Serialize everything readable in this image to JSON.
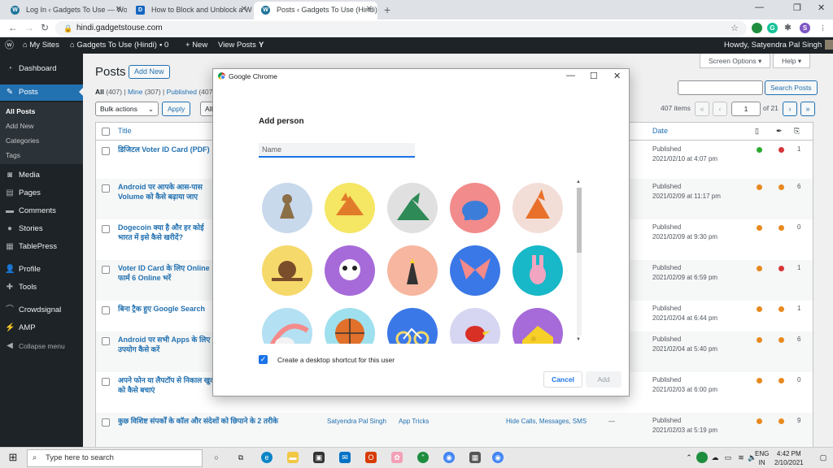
{
  "browser": {
    "tabs": [
      {
        "label": "Log In ‹ Gadgets To Use — WordPress",
        "fav": "W"
      },
      {
        "label": "How to Block and Unblock a Website",
        "fav": "D"
      },
      {
        "label": "Posts ‹ Gadgets To Use (Hindi) — WordPress",
        "fav": "W"
      }
    ],
    "url": "hindi.gadgetstouse.com",
    "profile_initial": "S"
  },
  "adminbar": {
    "my_sites": "My Sites",
    "site_name": "Gadgets To Use (Hindi)",
    "comments_count": "0",
    "new": "New",
    "view_posts": "View Posts",
    "howdy": "Howdy, Satyendra Pal Singh"
  },
  "sidebar": {
    "items": [
      {
        "label": "Dashboard",
        "icon": "dashboard-icon"
      },
      {
        "label": "Posts",
        "icon": "pin-icon"
      },
      {
        "label": "Media",
        "icon": "media-icon"
      },
      {
        "label": "Pages",
        "icon": "pages-icon"
      },
      {
        "label": "Comments",
        "icon": "comments-icon"
      },
      {
        "label": "Stories",
        "icon": "stories-icon"
      },
      {
        "label": "TablePress",
        "icon": "table-icon"
      },
      {
        "label": "Profile",
        "icon": "profile-icon"
      },
      {
        "label": "Tools",
        "icon": "tools-icon"
      },
      {
        "label": "Crowdsignal",
        "icon": "crowdsignal-icon"
      },
      {
        "label": "AMP",
        "icon": "amp-icon"
      },
      {
        "label": "Collapse menu",
        "icon": "collapse-icon"
      }
    ],
    "submenu": [
      "All Posts",
      "Add New",
      "Categories",
      "Tags"
    ]
  },
  "main": {
    "title": "Posts",
    "add_new": "Add New",
    "screen_options": "Screen Options ▾",
    "help": "Help ▾",
    "filters": {
      "all": "All",
      "all_count": "(407)",
      "mine": "Mine",
      "mine_count": "(307)",
      "published": "Published",
      "published_count": "(407"
    },
    "search_button": "Search Posts",
    "bulk_actions": "Bulk actions",
    "apply": "Apply",
    "filter_all_partial": "All",
    "items_count": "407 items",
    "page_input": "1",
    "of_pages": "of 21",
    "col_title": "Title",
    "col_date": "Date",
    "rows": [
      {
        "title": "डिजिटल Voter ID Card (PDF)",
        "status": "Published",
        "date": "2021/02/10 at 4:07 pm",
        "seo": "#2eaa2e",
        "read": "#d63638",
        "comments": "1"
      },
      {
        "title": "Android पर आपके आस-पास Volume को कैसे बढ़ाया जाए",
        "status": "Published",
        "date": "2021/02/09 at 11:17 pm",
        "seo": "#e8891f",
        "read": "#e8891f",
        "comments": "6"
      },
      {
        "title": "Dogecoin क्या है और हर कोई भारत में इसे कैसे खरीदें?",
        "status": "Published",
        "date": "2021/02/09 at 9:30 pm",
        "seo": "#e8891f",
        "read": "#e8891f",
        "comments": "0"
      },
      {
        "title": "Voter ID Card के लिए Online फार्म 6 Online भरें",
        "status": "Published",
        "date": "2021/02/09 at 6:59 pm",
        "seo": "#e8891f",
        "read": "#d63638",
        "comments": "1"
      },
      {
        "title": "बिना ट्रैक हुए Google Search",
        "status": "Published",
        "date": "2021/02/04 at 6:44 pm",
        "seo": "#e8891f",
        "read": "#e8891f",
        "comments": "1"
      },
      {
        "title": "Android पर सभी Apps के लिए उपयोग कैसे करें",
        "status": "Published",
        "date": "2021/02/04 at 5:40 pm",
        "seo": "#e8891f",
        "read": "#e8891f",
        "comments": "6"
      },
      {
        "title": "अपने फोन या लैपटॉप से निकाल खुद को कैसे बचाएं",
        "status": "Published",
        "date": "2021/02/03 at 6:00 pm",
        "seo": "#e8891f",
        "read": "#e8891f",
        "comments": "0"
      },
      {
        "title": "कुछ विशिष्ट संपर्कों के कॉल और संदेशों को छिपाने के 2 तरीके",
        "author": "Satyendra Pal Singh",
        "category": "App Tricks",
        "tags": "Hide Calls, Messages, SMS",
        "dash": "—",
        "status": "Published",
        "date": "2021/02/03 at 5:19 pm",
        "seo": "#e8891f",
        "read": "#e8891f",
        "comments": "9"
      }
    ]
  },
  "dialog": {
    "window_title": "Google Chrome",
    "heading": "Add person",
    "name_placeholder": "Name",
    "shortcut_label": "Create a desktop shortcut for this user",
    "shortcut_checked": true,
    "cancel": "Cancel",
    "add": "Add",
    "avatars": [
      {
        "name": "cat-avatar",
        "bg": "#c9d9ec",
        "fg": "#8b6f47"
      },
      {
        "name": "fox-avatar",
        "bg": "#f5e663",
        "fg": "#e07b2a"
      },
      {
        "name": "dragon-avatar",
        "bg": "#e0e0e0",
        "fg": "#2e8b57"
      },
      {
        "name": "elephant-avatar",
        "bg": "#f28b8b",
        "fg": "#3b7dd8"
      },
      {
        "name": "fox-origami-avatar",
        "bg": "#f3ded7",
        "fg": "#e8702a"
      },
      {
        "name": "monkey-avatar",
        "bg": "#f6d96b",
        "fg": "#7a4e2a"
      },
      {
        "name": "panda-avatar",
        "bg": "#a66bd9",
        "fg": "#ffffff"
      },
      {
        "name": "penguin-avatar",
        "bg": "#f7b6a0",
        "fg": "#333333"
      },
      {
        "name": "butterfly-avatar",
        "bg": "#3b78e7",
        "fg": "#f58a8a"
      },
      {
        "name": "rabbit-avatar",
        "bg": "#18b8c8",
        "fg": "#f2a5c0"
      },
      {
        "name": "unicorn-avatar",
        "bg": "#b3e0f2",
        "fg": "#f3f3f3"
      },
      {
        "name": "basketball-avatar",
        "bg": "#9fe0ef",
        "fg": "#e0702a"
      },
      {
        "name": "bike-avatar",
        "bg": "#3b78e7",
        "fg": "#f6d96b"
      },
      {
        "name": "bird-avatar",
        "bg": "#d6d6f2",
        "fg": "#d93025"
      },
      {
        "name": "cheese-avatar",
        "bg": "#a66bd9",
        "fg": "#f6d028"
      }
    ]
  },
  "taskbar": {
    "search_placeholder": "Type here to search",
    "lang": "ENG",
    "region": "IN",
    "time": "4:42 PM",
    "date": "2/10/2021"
  }
}
